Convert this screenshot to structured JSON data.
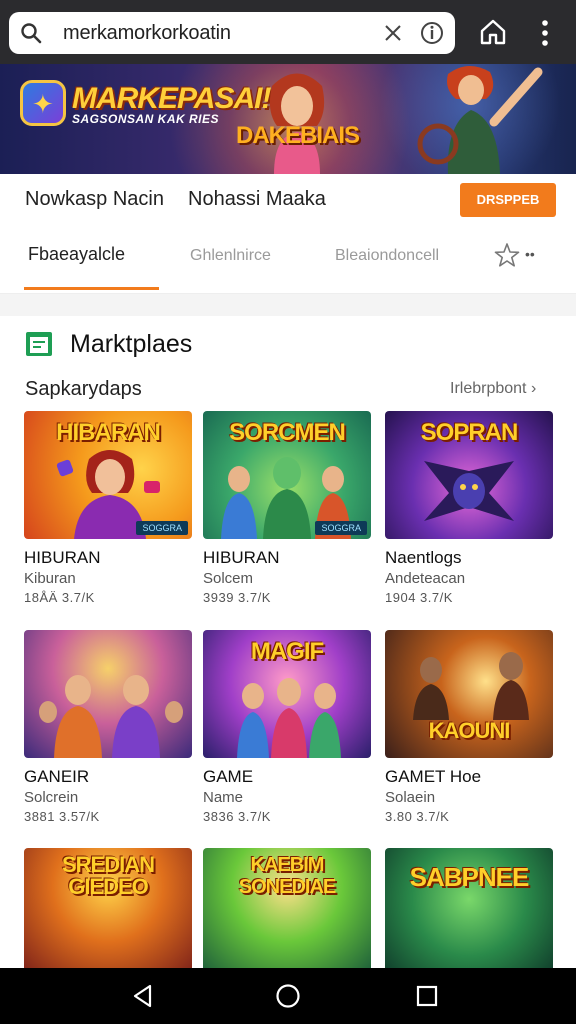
{
  "browser": {
    "url": "merkamorkorkoatin",
    "icons": [
      "search-icon",
      "clear-icon",
      "info-icon",
      "home-icon",
      "more-vert-icon"
    ]
  },
  "banner": {
    "title": "MARKEPASAI!",
    "subtitle": "SAGSONSAN KAK RIES",
    "badge": "DAKEBIAIS"
  },
  "nav": {
    "item_1": "Nowkasp Nacin",
    "item_2": "Nohassi Maaka",
    "cta": "DRSPPEB"
  },
  "tabs": [
    {
      "label": "Fbaeayalcle",
      "active": true
    },
    {
      "label": "Ghlenlnirce",
      "active": false
    },
    {
      "label": "Bleaiondoncell",
      "active": false
    }
  ],
  "tabs_more": "••",
  "section": {
    "title": "Marktplaes",
    "subtitle": "Sapkarydaps",
    "link": "Irlebrpbont ›"
  },
  "cards": [
    {
      "thumb_title": "HIBARAN",
      "tag": "SOGGRA",
      "name": "HIBURAN",
      "category": "Kiburan",
      "stats": "18ÅÄ 3.7/K"
    },
    {
      "thumb_title": "SORCMEN",
      "tag": "SOGGRA",
      "name": "HIBURAN",
      "category": "Solcem",
      "stats": "3939 3.7/K"
    },
    {
      "thumb_title": "SOPRAN",
      "tag": "",
      "name": "Naentlogs",
      "category": "Andeteacan",
      "stats": "1904 3.7/K"
    },
    {
      "thumb_title": "",
      "tag": "",
      "name": "GANEIR",
      "category": "Solcrein",
      "stats": "3881 3.57/K"
    },
    {
      "thumb_title": "MAGIF",
      "tag": "",
      "name": "GAME",
      "category": "Name",
      "stats": "3836 3.7/K"
    },
    {
      "thumb_title": "KAOUNI",
      "tag": "",
      "name": "GAMET Hoe",
      "category": "Solaein",
      "stats": "3.80 3.7/K"
    },
    {
      "thumb_title": "SREDIAN GIEDEO",
      "tag": "",
      "name": "",
      "category": "",
      "stats": ""
    },
    {
      "thumb_title": "KAEBIM SONEDIAE",
      "tag": "",
      "name": "",
      "category": "",
      "stats": ""
    },
    {
      "thumb_title": "SABPNEE",
      "tag": "",
      "name": "",
      "category": "",
      "stats": ""
    }
  ],
  "colors": {
    "accent": "#f27b1c",
    "topbar": "#2b2b2e",
    "android_nav": "#000000"
  }
}
